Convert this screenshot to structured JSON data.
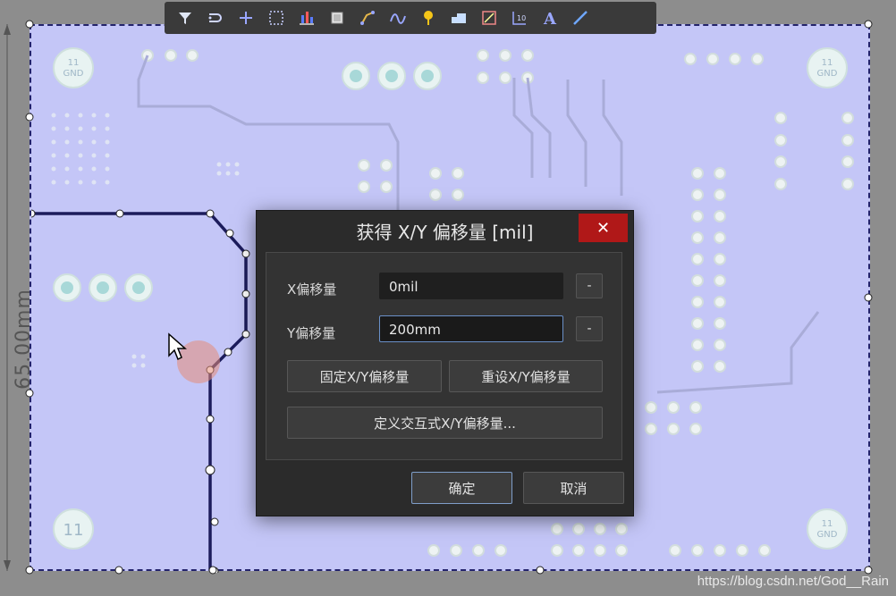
{
  "toolbar": {
    "items": [
      {
        "name": "filter-icon"
      },
      {
        "name": "route-icon"
      },
      {
        "name": "crosshair-icon"
      },
      {
        "name": "select-rect-icon"
      },
      {
        "name": "align-icon"
      },
      {
        "name": "component-icon"
      },
      {
        "name": "track-icon"
      },
      {
        "name": "diff-pair-icon"
      },
      {
        "name": "via-icon"
      },
      {
        "name": "polygon-icon"
      },
      {
        "name": "measure-icon"
      },
      {
        "name": "dimension-icon"
      },
      {
        "name": "text-icon"
      },
      {
        "name": "line-icon"
      }
    ]
  },
  "board": {
    "dimension_text": "65.00mm",
    "gnd_label": "GND",
    "net_label": "11"
  },
  "dialog": {
    "title": "获得 X/Y 偏移量 [mil]",
    "close": "✕",
    "x_label": "X偏移量",
    "x_value": "0mil",
    "y_label": "Y偏移量",
    "y_value": "200mm",
    "minus": "-",
    "fix_button": "固定X/Y偏移量",
    "reset_button": "重设X/Y偏移量",
    "define_button": "定义交互式X/Y偏移量...",
    "ok_button": "确定",
    "cancel_button": "取消"
  },
  "watermark": "https://blog.csdn.net/God__Rain",
  "colors": {
    "board": "#c4c6f7",
    "dialog": "#2b2b2b",
    "close": "#b01818",
    "outline": "#23236b"
  }
}
